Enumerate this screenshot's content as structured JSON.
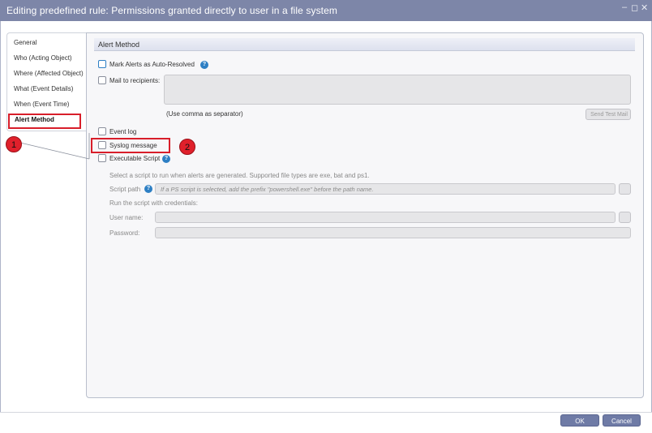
{
  "window": {
    "title": "Editing predefined rule: Permissions granted directly to user in a file system",
    "minimize": "–",
    "maximize": "◻",
    "close": "✕"
  },
  "nav": {
    "items": [
      {
        "label": "General"
      },
      {
        "label": "Who (Acting Object)"
      },
      {
        "label": "Where (Affected Object)"
      },
      {
        "label": "What (Event Details)"
      },
      {
        "label": "When (Event Time)"
      },
      {
        "label": "Alert Method"
      }
    ],
    "active_index": 5
  },
  "section": {
    "title": "Alert Method"
  },
  "options": {
    "auto_resolved": {
      "label": "Mark Alerts as Auto-Resolved",
      "checked": false,
      "help": "?"
    },
    "mail": {
      "label": "Mail to recipients:",
      "checked": false,
      "hint": "(Use comma as separator)",
      "send_test": "Send Test Mail"
    },
    "event_log": {
      "label": "Event log",
      "checked": false
    },
    "syslog": {
      "label": "Syslog message",
      "checked": false
    },
    "script": {
      "label": "Executable Script",
      "checked": false,
      "help": "?"
    }
  },
  "script": {
    "description": "Select a script to run when alerts are generated. Supported file types are exe, bat and ps1.",
    "path_label": "Script path",
    "path_help": "?",
    "path_placeholder": "If a PS script is selected, add the prefix \"powershell.exe\" before the path name.",
    "credentials_label": "Run the script with credentials:",
    "username_label": "User name:",
    "password_label": "Password:"
  },
  "annotations": {
    "one": "1",
    "two": "2",
    "color": "#e0202b"
  },
  "footer": {
    "ok": "OK",
    "cancel": "Cancel"
  }
}
